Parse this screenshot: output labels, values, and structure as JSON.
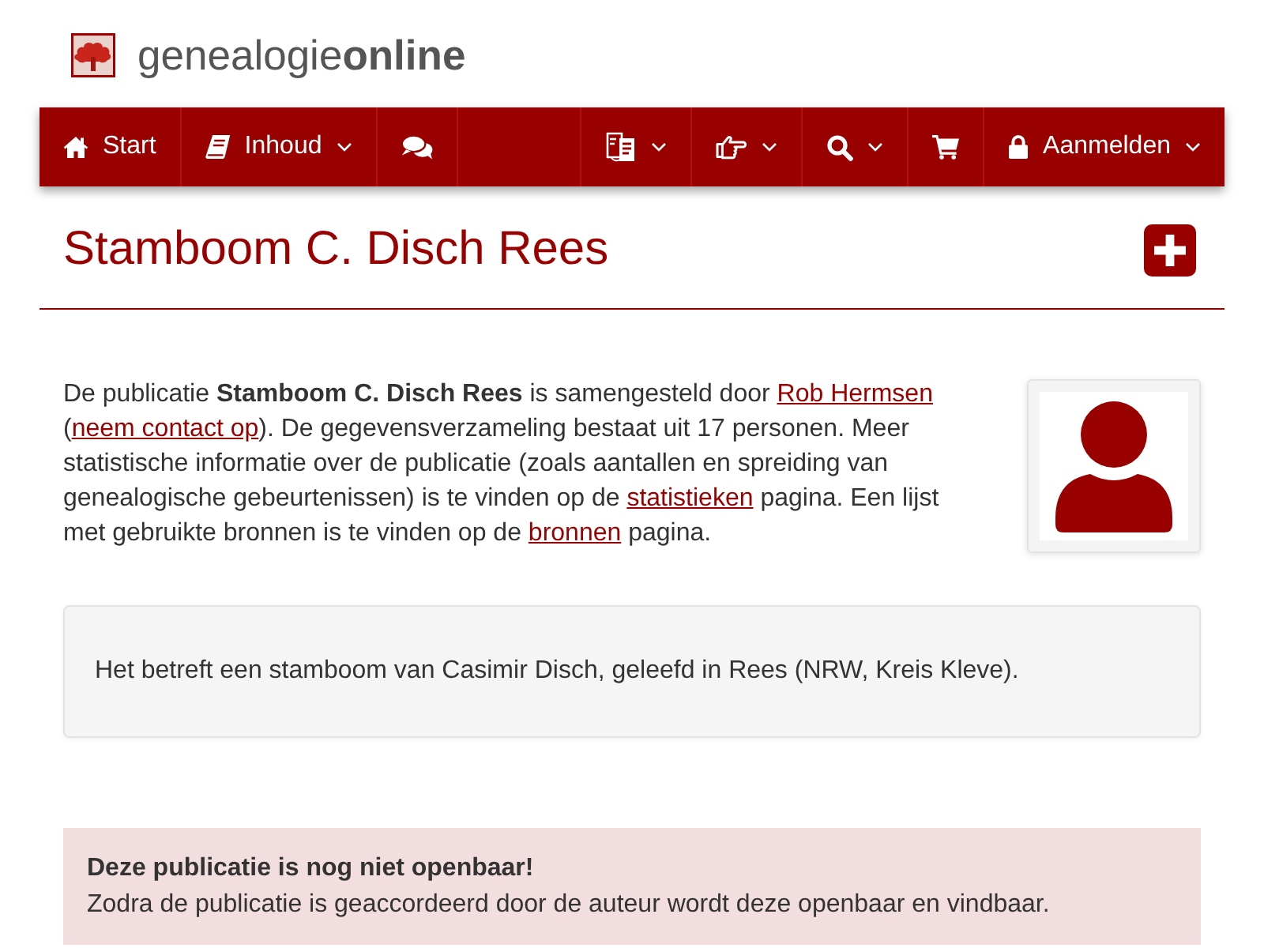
{
  "logo": {
    "text": "genealogie**online**"
  },
  "nav": {
    "left": [
      {
        "label": "Start",
        "dropdown": false
      },
      {
        "label": "Inhoud",
        "dropdown": true
      },
      {
        "dropdown": false
      }
    ],
    "right": [
      {
        "dropdown": true
      },
      {
        "dropdown": true
      },
      {
        "dropdown": true
      },
      {
        "dropdown": false
      },
      {
        "label": "Aanmelden",
        "dropdown": true
      }
    ]
  },
  "page": {
    "title": "Stamboom C. Disch Rees"
  },
  "intro": {
    "parts": [
      {
        "kind": "text",
        "text": "De publicatie **Stamboom C. Disch Rees** is samengesteld door "
      },
      {
        "kind": "link",
        "text": "Rob Hermsen"
      },
      {
        "kind": "text",
        "text": " ("
      },
      {
        "kind": "link",
        "text": "neem contact op"
      },
      {
        "kind": "text",
        "text": "). De gegevensverzameling bestaat uit 17 personen. Meer statistische informatie over de publicatie (zoals aantallen en spreiding van genealogische gebeurtenissen) is te vinden op de "
      },
      {
        "kind": "link",
        "text": "statistieken"
      },
      {
        "kind": "text",
        "text": " pagina. Een lijst met gebruikte bronnen is te vinden op de "
      },
      {
        "kind": "link",
        "text": "bronnen"
      },
      {
        "kind": "text",
        "text": " pagina."
      }
    ]
  },
  "description": "Het betreft een stamboom van Casimir Disch, geleefd in Rees (NRW, Kreis Kleve).",
  "notice": {
    "title": "Deze publicatie is nog niet openbaar!",
    "message": "Zodra de publicatie is geaccordeerd door de auteur wordt deze openbaar en vindbaar."
  }
}
